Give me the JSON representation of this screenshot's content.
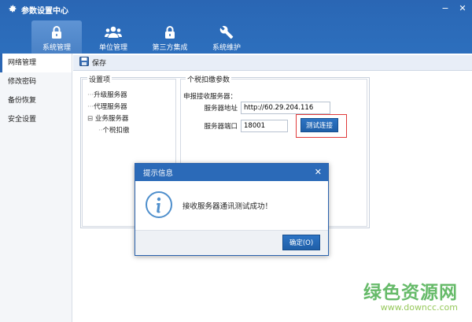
{
  "window": {
    "title": "参数设置中心"
  },
  "tabs": [
    {
      "label": "系统管理",
      "icon": "lock-icon",
      "active": true
    },
    {
      "label": "单位管理",
      "icon": "users-icon"
    },
    {
      "label": "第三方集成",
      "icon": "lock-icon"
    },
    {
      "label": "系统维护",
      "icon": "wrench-icon"
    }
  ],
  "sidebar": {
    "items": [
      {
        "label": "网络管理",
        "active": true
      },
      {
        "label": "修改密码"
      },
      {
        "label": "备份恢复"
      },
      {
        "label": "安全设置"
      }
    ]
  },
  "toolbar": {
    "save_label": "保存"
  },
  "settings_group": {
    "legend": "设置项",
    "tree": [
      "升级服务器",
      "代理服务器",
      "业务服务器",
      "个税扣缴"
    ]
  },
  "tax_group": {
    "legend": "个税扣缴参数",
    "section_label": "申报接收服务器：",
    "address_label": "服务器地址",
    "address_value": "http://60.29.204.116",
    "port_label": "服务器端口",
    "port_value": "18001",
    "test_button": "测试连接"
  },
  "dialog": {
    "title": "提示信息",
    "message": "接收服务器通讯测试成功！",
    "ok_label": "确定(O)"
  },
  "watermark": {
    "cn": "绿色资源网",
    "en": "www.downcc.com"
  },
  "colors": {
    "accent": "#2a66b4",
    "highlight": "#e03a3a"
  }
}
